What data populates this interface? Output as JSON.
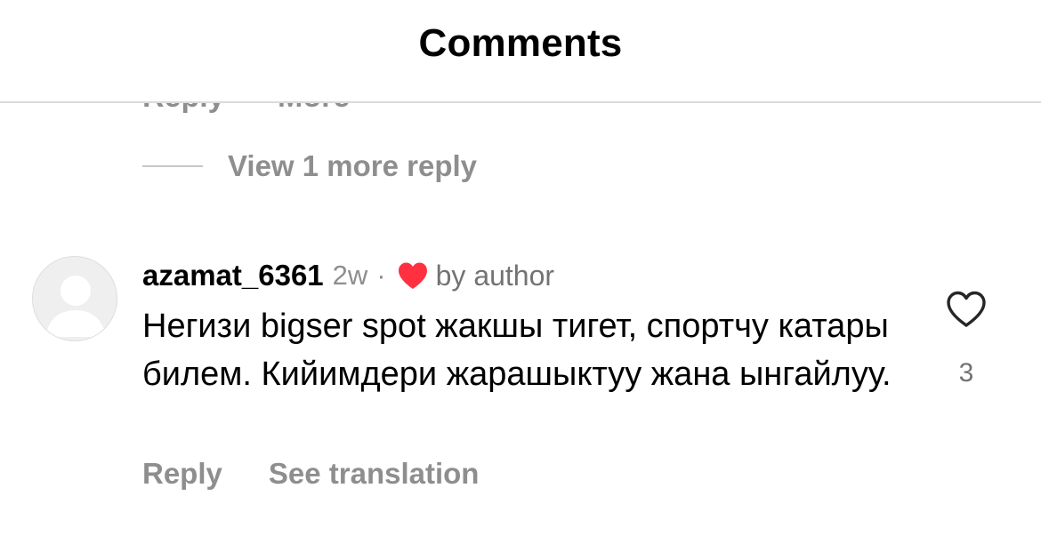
{
  "header": {
    "title": "Comments"
  },
  "previous_comment": {
    "actions": [
      "Reply",
      "More"
    ]
  },
  "view_replies": {
    "label": "View 1 more reply"
  },
  "comment": {
    "username": "azamat_6361",
    "time": "2w",
    "separator": "·",
    "liked_by_author_label": "by author",
    "text": "Негизи bigser spot жакшы тигет, спортчу катары билем. Кийимдери жарашыктуу жана ынгайлуу.",
    "like_count": "3",
    "actions": {
      "reply": "Reply",
      "see_translation": "See translation"
    }
  },
  "icons": {
    "avatar": "default-avatar-icon",
    "author_heart": "heart-filled-icon",
    "like": "heart-outline-icon"
  },
  "colors": {
    "author_heart": "#ff3040",
    "secondary_text": "#8e8e8e",
    "divider": "#dbdbdb"
  }
}
